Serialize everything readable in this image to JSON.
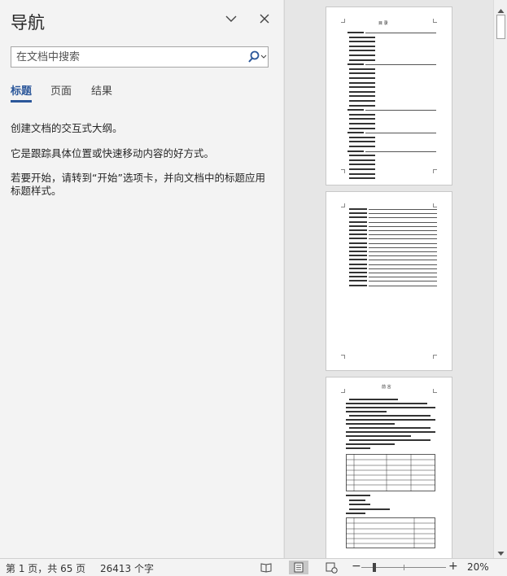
{
  "nav": {
    "title": "导航",
    "search_placeholder": "在文档中搜索",
    "tabs": [
      {
        "label": "标题",
        "active": true
      },
      {
        "label": "页面",
        "active": false
      },
      {
        "label": "结果",
        "active": false
      }
    ],
    "messages": [
      "创建文档的交互式大纲。",
      "它是跟踪具体位置或快速移动内容的好方式。",
      "若要开始，请转到“开始”选项卡，并向文档中的标题应用标题样式。"
    ]
  },
  "document": {
    "page1_heading": "目 录",
    "page3_heading": "前 言"
  },
  "status": {
    "page_info": "第 1 页，共 65 页",
    "word_count": "26413 个字",
    "zoom_minus": "−",
    "zoom_plus": "+",
    "zoom_level": "20%",
    "zoom_fraction": 0.2
  },
  "colors": {
    "accent": "#2b579a"
  }
}
